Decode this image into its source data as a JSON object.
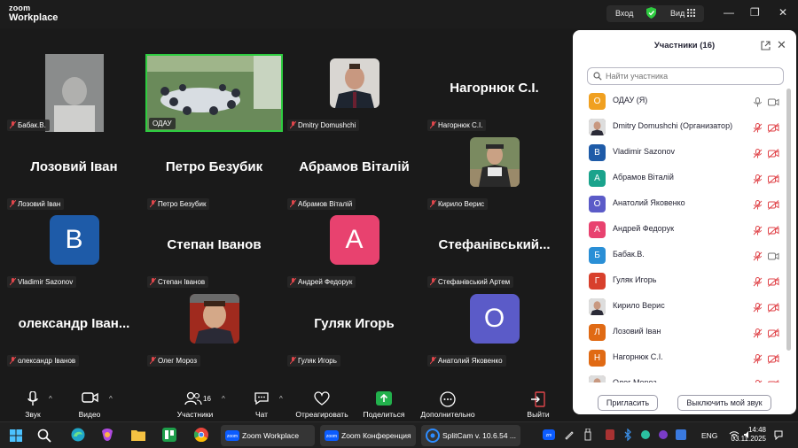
{
  "app": {
    "logo_top": "zoom",
    "logo_bottom": "Workplace"
  },
  "titlebar": {
    "enter_label": "Вход",
    "view_label": "Вид"
  },
  "tiles": [
    {
      "label": "Бабак.В.",
      "type": "photo"
    },
    {
      "label": "ОДАУ",
      "type": "photo",
      "active": true
    },
    {
      "label": "Dmitry Domushchi",
      "type": "photo"
    },
    {
      "label": "Нагорнюк С.І.",
      "type": "name",
      "big": "Нагорнюк С.І."
    },
    {
      "label": "Лозовий Іван",
      "type": "name",
      "big": "Лозовий Іван"
    },
    {
      "label": "Петро Безубик",
      "type": "name",
      "big": "Петро Безубик"
    },
    {
      "label": "Абрамов Віталій",
      "type": "name",
      "big": "Абрамов Віталій"
    },
    {
      "label": "Кирило Верис",
      "type": "photo"
    },
    {
      "label": "Vladimir Sazonov",
      "type": "avatar",
      "letter": "B",
      "color": "#1e5ba8"
    },
    {
      "label": "Степан Іванов",
      "type": "name",
      "big": "Степан Іванов"
    },
    {
      "label": "Андрей Федорук",
      "type": "avatar",
      "letter": "A",
      "color": "#e8426f"
    },
    {
      "label": "Стефанівський Артем",
      "type": "name",
      "big": "Стефанівський..."
    },
    {
      "label": "олександр Іванов",
      "type": "name",
      "big": "олександр Іван..."
    },
    {
      "label": "Олег Мороз",
      "type": "photo"
    },
    {
      "label": "Гуляк Игорь",
      "type": "name",
      "big": "Гуляк Игорь"
    },
    {
      "label": "Анатолий Яковенко",
      "type": "avatar",
      "letter": "O",
      "color": "#5b5bc8"
    }
  ],
  "panel": {
    "title": "Участники (16)",
    "search_placeholder": "Найти участника",
    "invite_label": "Пригласить",
    "mute_me_label": "Выключить мой звук",
    "participants": [
      {
        "name": "ОДАУ (Я)",
        "letter": "O",
        "color": "#f0a020",
        "muted": false,
        "video": true
      },
      {
        "name": "Dmitry Domushchi (Организатор)",
        "letter": "",
        "color": "#7a6a60",
        "muted": true,
        "video": false
      },
      {
        "name": "Vladimir Sazonov",
        "letter": "B",
        "color": "#1e5ba8",
        "muted": true,
        "video": false
      },
      {
        "name": "Абрамов Віталій",
        "letter": "A",
        "color": "#1aa38c",
        "muted": true,
        "video": false
      },
      {
        "name": "Анатолий Яковенко",
        "letter": "O",
        "color": "#5b5bc8",
        "muted": true,
        "video": false
      },
      {
        "name": "Андрей Федорук",
        "letter": "A",
        "color": "#e8426f",
        "muted": true,
        "video": false
      },
      {
        "name": "Бабак.В.",
        "letter": "Б",
        "color": "#2a8fd6",
        "muted": true,
        "video": true
      },
      {
        "name": "Гуляк Игорь",
        "letter": "Г",
        "color": "#d8402c",
        "muted": true,
        "video": false
      },
      {
        "name": "Кирило Верис",
        "letter": "",
        "color": "#8a8a6a",
        "muted": true,
        "video": false
      },
      {
        "name": "Лозовий Іван",
        "letter": "Л",
        "color": "#e06a14",
        "muted": true,
        "video": false
      },
      {
        "name": "Нагорнюк С.І.",
        "letter": "Н",
        "color": "#e06a14",
        "muted": true,
        "video": false
      },
      {
        "name": "Олег Мороз",
        "letter": "",
        "color": "#8a6050",
        "muted": true,
        "video": false
      }
    ]
  },
  "toolbar": {
    "audio": "Звук",
    "video": "Видео",
    "participants": "Участники",
    "participants_count": "16",
    "chat": "Чат",
    "react": "Отреагировать",
    "share": "Поделиться",
    "more": "Дополнительно",
    "leave": "Выйти"
  },
  "taskbar": {
    "app1": "Zoom Workplace",
    "app2": "Zoom Конференция",
    "app3": "SplitCam v. 10.6.54 ...",
    "lang": "ENG",
    "time": "14:48",
    "date": "03.11.2025"
  },
  "colors": {
    "accent_green": "#2ecc40",
    "mute_red": "#e0464b",
    "share_green": "#22b14c"
  }
}
